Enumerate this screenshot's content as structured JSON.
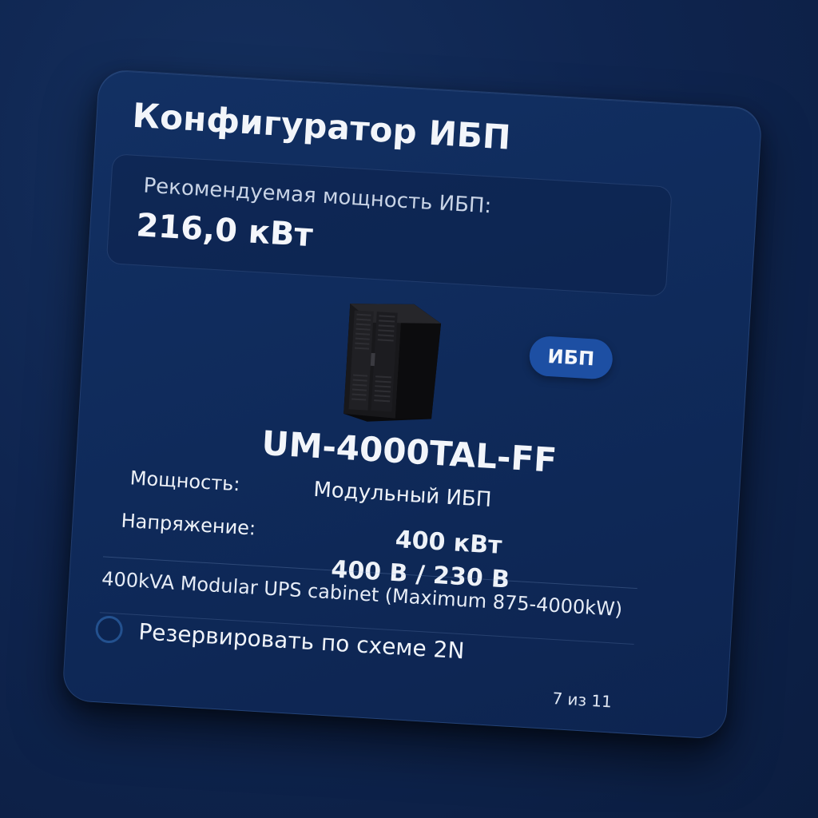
{
  "title": "Конфигуратор ИБП",
  "recommendation": {
    "label": "Рекомендуемая мощность ИБП:",
    "value": "216,0 кВт"
  },
  "product": {
    "badge": "ИБП",
    "model": "UM-4000TAL-FF",
    "image_icon": "ups-cabinet-icon",
    "specs": {
      "power_label": "Мощность:",
      "voltage_label": "Напряжение:",
      "type_value": "Модульный ИБП",
      "power_value": "400 кВт",
      "voltage_value": "400 В / 230 В"
    },
    "description": "400kVA Modular UPS cabinet (Maximum 875-4000kW)"
  },
  "option": {
    "label": "Резервировать по схеме 2N",
    "checked": false
  },
  "pager": "7 из 11",
  "colors": {
    "background": "#0f2550",
    "card": "#123063",
    "badge": "#1d4fa3",
    "radio_border": "#23518f"
  }
}
